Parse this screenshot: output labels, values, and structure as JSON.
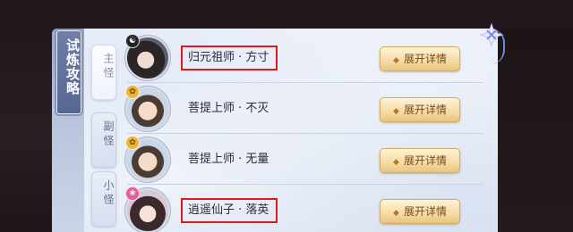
{
  "panel": {
    "title": "试炼攻略",
    "close_icon": "close-star-icon"
  },
  "tabs": [
    {
      "label": "主怪",
      "active": true
    },
    {
      "label": "副怪",
      "active": false
    },
    {
      "label": "小怪",
      "active": false
    }
  ],
  "rows": [
    {
      "name": "归元祖师 · 方寸",
      "badge": "☯",
      "badge_icon": "yin-yang-icon",
      "highlighted": true,
      "button": "展开详情"
    },
    {
      "name": "菩提上师 · 不灭",
      "badge": "✿",
      "badge_icon": "gold-lotus-icon",
      "highlighted": false,
      "button": "展开详情"
    },
    {
      "name": "菩提上师 · 无量",
      "badge": "✿",
      "badge_icon": "gold-lotus-icon",
      "highlighted": false,
      "button": "展开详情"
    },
    {
      "name": "逍遥仙子 · 落英",
      "badge": "❀",
      "badge_icon": "pink-flower-icon",
      "highlighted": true,
      "button": "展开详情"
    }
  ],
  "button_icon": "◆",
  "colors": {
    "highlight_border": "#e0191f",
    "button_gold": "#f5dba4",
    "title_tag": "#56668f"
  }
}
